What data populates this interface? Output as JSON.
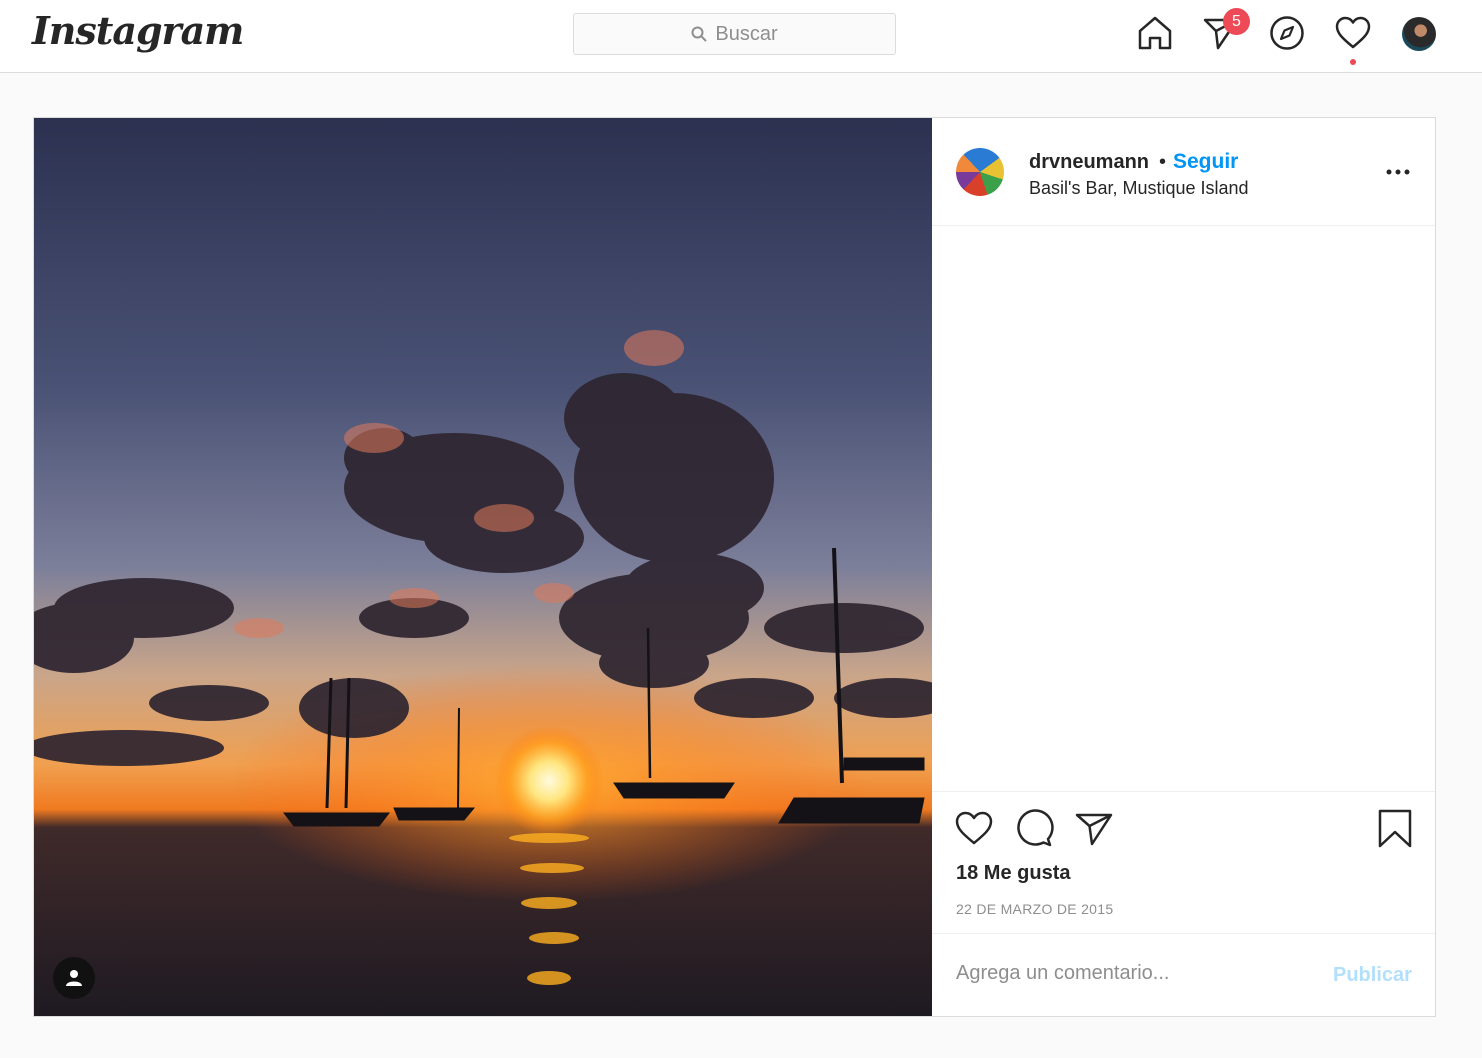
{
  "header": {
    "logo": "Instagram",
    "search_placeholder": "Buscar",
    "direct_badge_count": "5",
    "icons": [
      "home-icon",
      "direct-icon",
      "explore-icon",
      "activity-icon",
      "profile-avatar"
    ]
  },
  "post": {
    "username": "drvneumann",
    "separator": "•",
    "follow_label": "Seguir",
    "location": "Basil's Bar, Mustique Island",
    "likes": "18 Me gusta",
    "date": "22 DE MARZO DE 2015",
    "comment_placeholder": "Agrega un comentario...",
    "publish_label": "Publicar",
    "photo_subject": "sunset-over-sea-with-sailboats"
  },
  "colors": {
    "accent_blue": "#0095f6",
    "badge_red": "#ed4956",
    "publish_disabled": "#b2dffc"
  }
}
